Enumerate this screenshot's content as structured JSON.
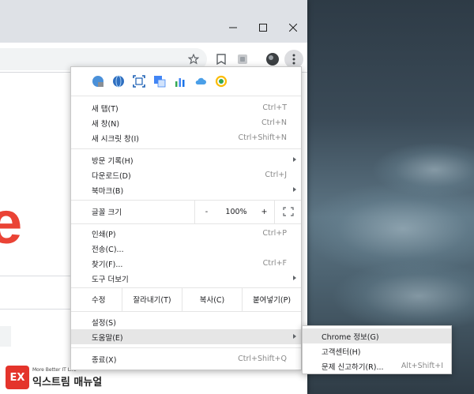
{
  "window_controls": {
    "minimize": "—",
    "maximize": "☐",
    "close": "✕"
  },
  "toolbar": {
    "star_icon": "☆",
    "bookmark_icon": "▯",
    "extension_icon": "▣",
    "avatar_icon": "●",
    "menu_icon": "⋮"
  },
  "menu": {
    "extensions": [
      "chrome-web-icon",
      "globe-icon",
      "screenshot-icon",
      "translate-icon",
      "chart-icon",
      "cloud-icon",
      "search-icon"
    ],
    "items": [
      {
        "label": "새 탭(T)",
        "shortcut": "Ctrl+T"
      },
      {
        "label": "새 창(N)",
        "shortcut": "Ctrl+N"
      },
      {
        "label": "새 시크릿 창(I)",
        "shortcut": "Ctrl+Shift+N"
      },
      {
        "label": "방문 기록(H)",
        "shortcut": ""
      },
      {
        "label": "다운로드(D)",
        "shortcut": "Ctrl+J"
      },
      {
        "label": "북마크(B)",
        "shortcut": ""
      },
      {
        "label": "인쇄(P)",
        "shortcut": "Ctrl+P"
      },
      {
        "label": "전송(C)...",
        "shortcut": ""
      },
      {
        "label": "찾기(F)...",
        "shortcut": "Ctrl+F"
      },
      {
        "label": "도구 더보기",
        "shortcut": ""
      },
      {
        "label": "설정(S)",
        "shortcut": ""
      },
      {
        "label": "도움말(E)",
        "shortcut": ""
      },
      {
        "label": "종료(X)",
        "shortcut": "Ctrl+Shift+Q"
      }
    ],
    "zoom": {
      "label": "글꼴 크기",
      "minus": "-",
      "value": "100%",
      "plus": "+",
      "fullscreen": "⛶"
    },
    "edit": {
      "label": "수정",
      "cut": "잘라내기(T)",
      "copy": "복사(C)",
      "paste": "붙여넣기(P)"
    }
  },
  "submenu": {
    "items": [
      {
        "label": "Chrome 정보(G)",
        "shortcut": ""
      },
      {
        "label": "고객센터(H)",
        "shortcut": ""
      },
      {
        "label": "문제 신고하기(R)...",
        "shortcut": "Alt+Shift+I"
      }
    ]
  },
  "page": {
    "logo_fragment": "e"
  },
  "watermark": {
    "logo": "EX",
    "tagline": "More Better IT Life",
    "name": "익스트림 매뉴얼"
  }
}
